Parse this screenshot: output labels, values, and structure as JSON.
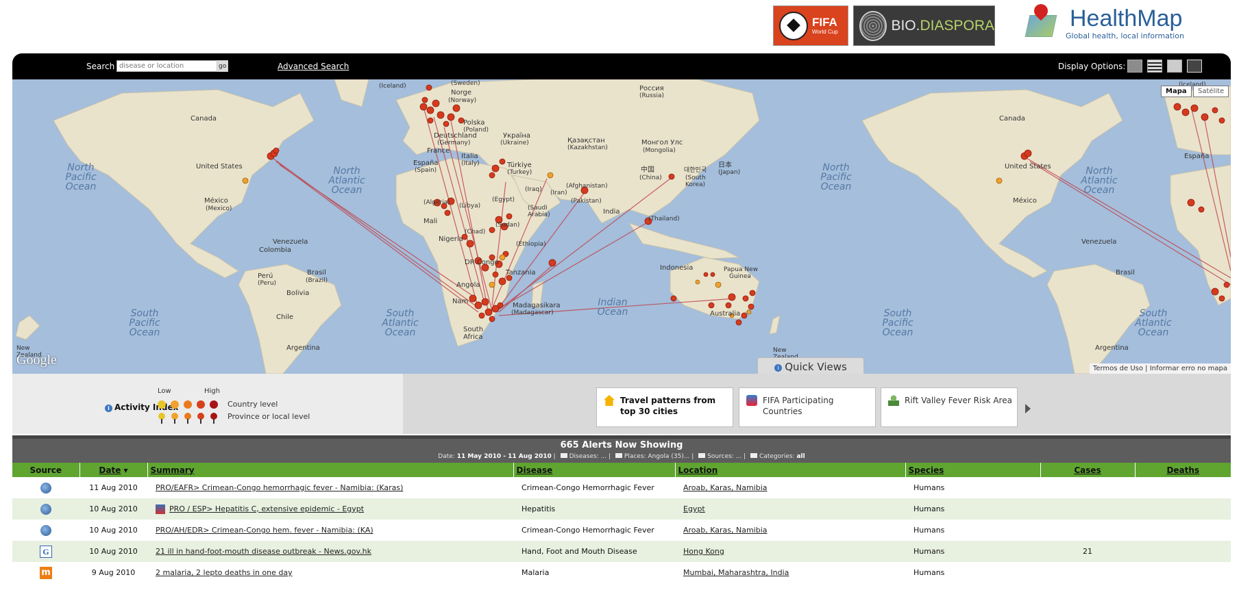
{
  "header": {
    "fifa_logo": {
      "main": "FIFA",
      "sub": "World Cup"
    },
    "biodiaspora_logo": {
      "part1": "BIO.",
      "part2": "DIASPORA"
    },
    "healthmap_logo": {
      "name": "HealthMap",
      "tagline": "Global health, local information"
    }
  },
  "search": {
    "label": "Search",
    "placeholder": "disease or location",
    "go_label": "go",
    "advanced_label": "Advanced Search"
  },
  "display_options": {
    "label": "Display Options:",
    "icons": [
      "map-view-icon",
      "list-view-icon",
      "split-view-icon",
      "fullscreen-icon"
    ],
    "selected": "map-view-icon"
  },
  "map": {
    "map_type_buttons": [
      "Mapa",
      "Satélite"
    ],
    "selected_map_type": "Mapa",
    "attribution": "Google",
    "footer_links": [
      "Termos de Uso",
      "Informar erro no mapa"
    ],
    "labels": {
      "canada": "Canada",
      "usa": "United States",
      "mexico": "México",
      "mexico_sub": "(Mexico)",
      "n_pac": [
        "North",
        "Pacific",
        "Ocean"
      ],
      "n_atl": [
        "North",
        "Atlantic",
        "Ocean"
      ],
      "s_pac": [
        "South",
        "Pacific",
        "Ocean"
      ],
      "s_atl": [
        "South",
        "Atlantic",
        "Ocean"
      ],
      "indian": [
        "Indian",
        "Ocean"
      ],
      "venezuela": "Venezuela",
      "colombia": "Colombia",
      "brasil": "Brasil",
      "brazil": "(Brazil)",
      "peru": "Perú",
      "peru_sub": "(Peru)",
      "bolivia": "Bolivia",
      "chile": "Chile",
      "argentina": "Argentina",
      "iceland": "(Iceland)",
      "sweden": "(Sweden)",
      "norge": "Norge",
      "norway": "(Norway)",
      "russia": "Россия",
      "russia_sub": "(Russia)",
      "polska": "Polska",
      "poland": "(Poland)",
      "ukraina": "Україна",
      "ukraine": "(Ukraine)",
      "deutschland": "Deutschland",
      "germany": "(Germany)",
      "france": "France",
      "espana": "España",
      "spain": "(Spain)",
      "italia": "Italia",
      "italy": "(Italy)",
      "turkiye": "Türkiye",
      "turkey": "(Turkey)",
      "kazakhstan": "Қазақстан",
      "kazakhstan_sub": "(Kazakhstan)",
      "mongolia": "Монгол Улс",
      "mongolia_sub": "(Mongolia)",
      "china": "中国",
      "china_sub": "(China)",
      "japan": "日本",
      "japan_sub": "(Japan)",
      "korea": "대한민국",
      "korea_sub1": "(South",
      "korea_sub2": "Korea)",
      "iraq": "(Iraq)",
      "iran": "(Iran)",
      "afghanistan": "(Afghanistan)",
      "pakistan": "(Pakistan)",
      "india": "India",
      "thailand": "(Thailand)",
      "egypt": "(Egypt)",
      "libya": "(Libya)",
      "algeria": "(Algeria)",
      "saudi": "(Saudi",
      "arabia": "Arabia)",
      "sudan": "(Sudan)",
      "mali": "Mali",
      "chad": "(Chad)",
      "nigeria": "Nigeria",
      "ethiopia": "(Ethiopia)",
      "drcongo": "DR Congo",
      "tanzania": "Tanzania",
      "angola": "Angola",
      "namibia": "Nam",
      "madagasikara": "Madagasikara",
      "madagascar": "(Madagascar)",
      "south_africa1": "South",
      "south_africa2": "Africa",
      "indonesia": "Indonesia",
      "png1": "Papua New",
      "png2": "Guinea",
      "australia": "Australia",
      "nz1": "New",
      "nz2": "Zealand"
    }
  },
  "quick_views": {
    "tab_label": "Quick Views",
    "cards": [
      {
        "label": "Travel patterns from top 30 cities",
        "icon": "house-icon"
      },
      {
        "label": "FIFA Participating Countries",
        "icon": "soccer-player-icon"
      },
      {
        "label": "Rift Valley Fever Risk Area",
        "icon": "person-icon"
      }
    ]
  },
  "legend": {
    "title": "Activity Index",
    "low": "Low",
    "high": "High",
    "country_level": "Country level",
    "province_level": "Province or local level",
    "colors": [
      "#e8c52a",
      "#f0a22c",
      "#ea7a1e",
      "#d6401d",
      "#a81414"
    ]
  },
  "alerts": {
    "title": "665 Alerts Now Showing",
    "filters": {
      "date_label": "Date:",
      "date_value": "11 May 2010 - 11 Aug 2010",
      "diseases": "Diseases: ...",
      "places": "Places: Angola (35)...",
      "sources": "Sources: ...",
      "categories_label": "Categories:",
      "categories_value": "all"
    },
    "columns": [
      "Source",
      "Date",
      "Summary",
      "Disease",
      "Location",
      "Species",
      "Cases",
      "Deaths"
    ],
    "rows": [
      {
        "source": "promed",
        "date": "11 Aug 2010",
        "summary": "PRO/EAFR> Crimean-Congo hemorrhagic fever - Namibia: (Karas)",
        "disease": "Crimean-Congo Hemorrhagic Fever",
        "location": "Aroab, Karas, Namibia",
        "species": "Humans",
        "cases": "",
        "deaths": ""
      },
      {
        "source": "promed",
        "date": "10 Aug 2010",
        "summary": "PRO / ESP> Hepatitis C, extensive epidemic - Egypt",
        "disease": "Hepatitis",
        "location": "Egypt",
        "species": "Humans",
        "cases": "",
        "deaths": ""
      },
      {
        "source": "promed",
        "date": "10 Aug 2010",
        "summary": "PRO/AH/EDR> Crimean-Congo hem. fever - Namibia: (KA)",
        "disease": "Crimean-Congo Hemorrhagic Fever",
        "location": "Aroab, Karas, Namibia",
        "species": "Humans",
        "cases": "",
        "deaths": ""
      },
      {
        "source": "google",
        "date": "10 Aug 2010",
        "summary": "21 ill in hand-foot-mouth disease outbreak - News.gov.hk",
        "disease": "Hand, Foot and Mouth Disease",
        "location": "Hong Kong",
        "species": "Humans",
        "cases": "21",
        "deaths": ""
      },
      {
        "source": "m",
        "date": "9 Aug 2010",
        "summary": "2 malaria, 2 lepto deaths in one day",
        "disease": "Malaria",
        "location": "Mumbai, Maharashtra, India",
        "species": "Humans",
        "cases": "",
        "deaths": ""
      }
    ]
  }
}
